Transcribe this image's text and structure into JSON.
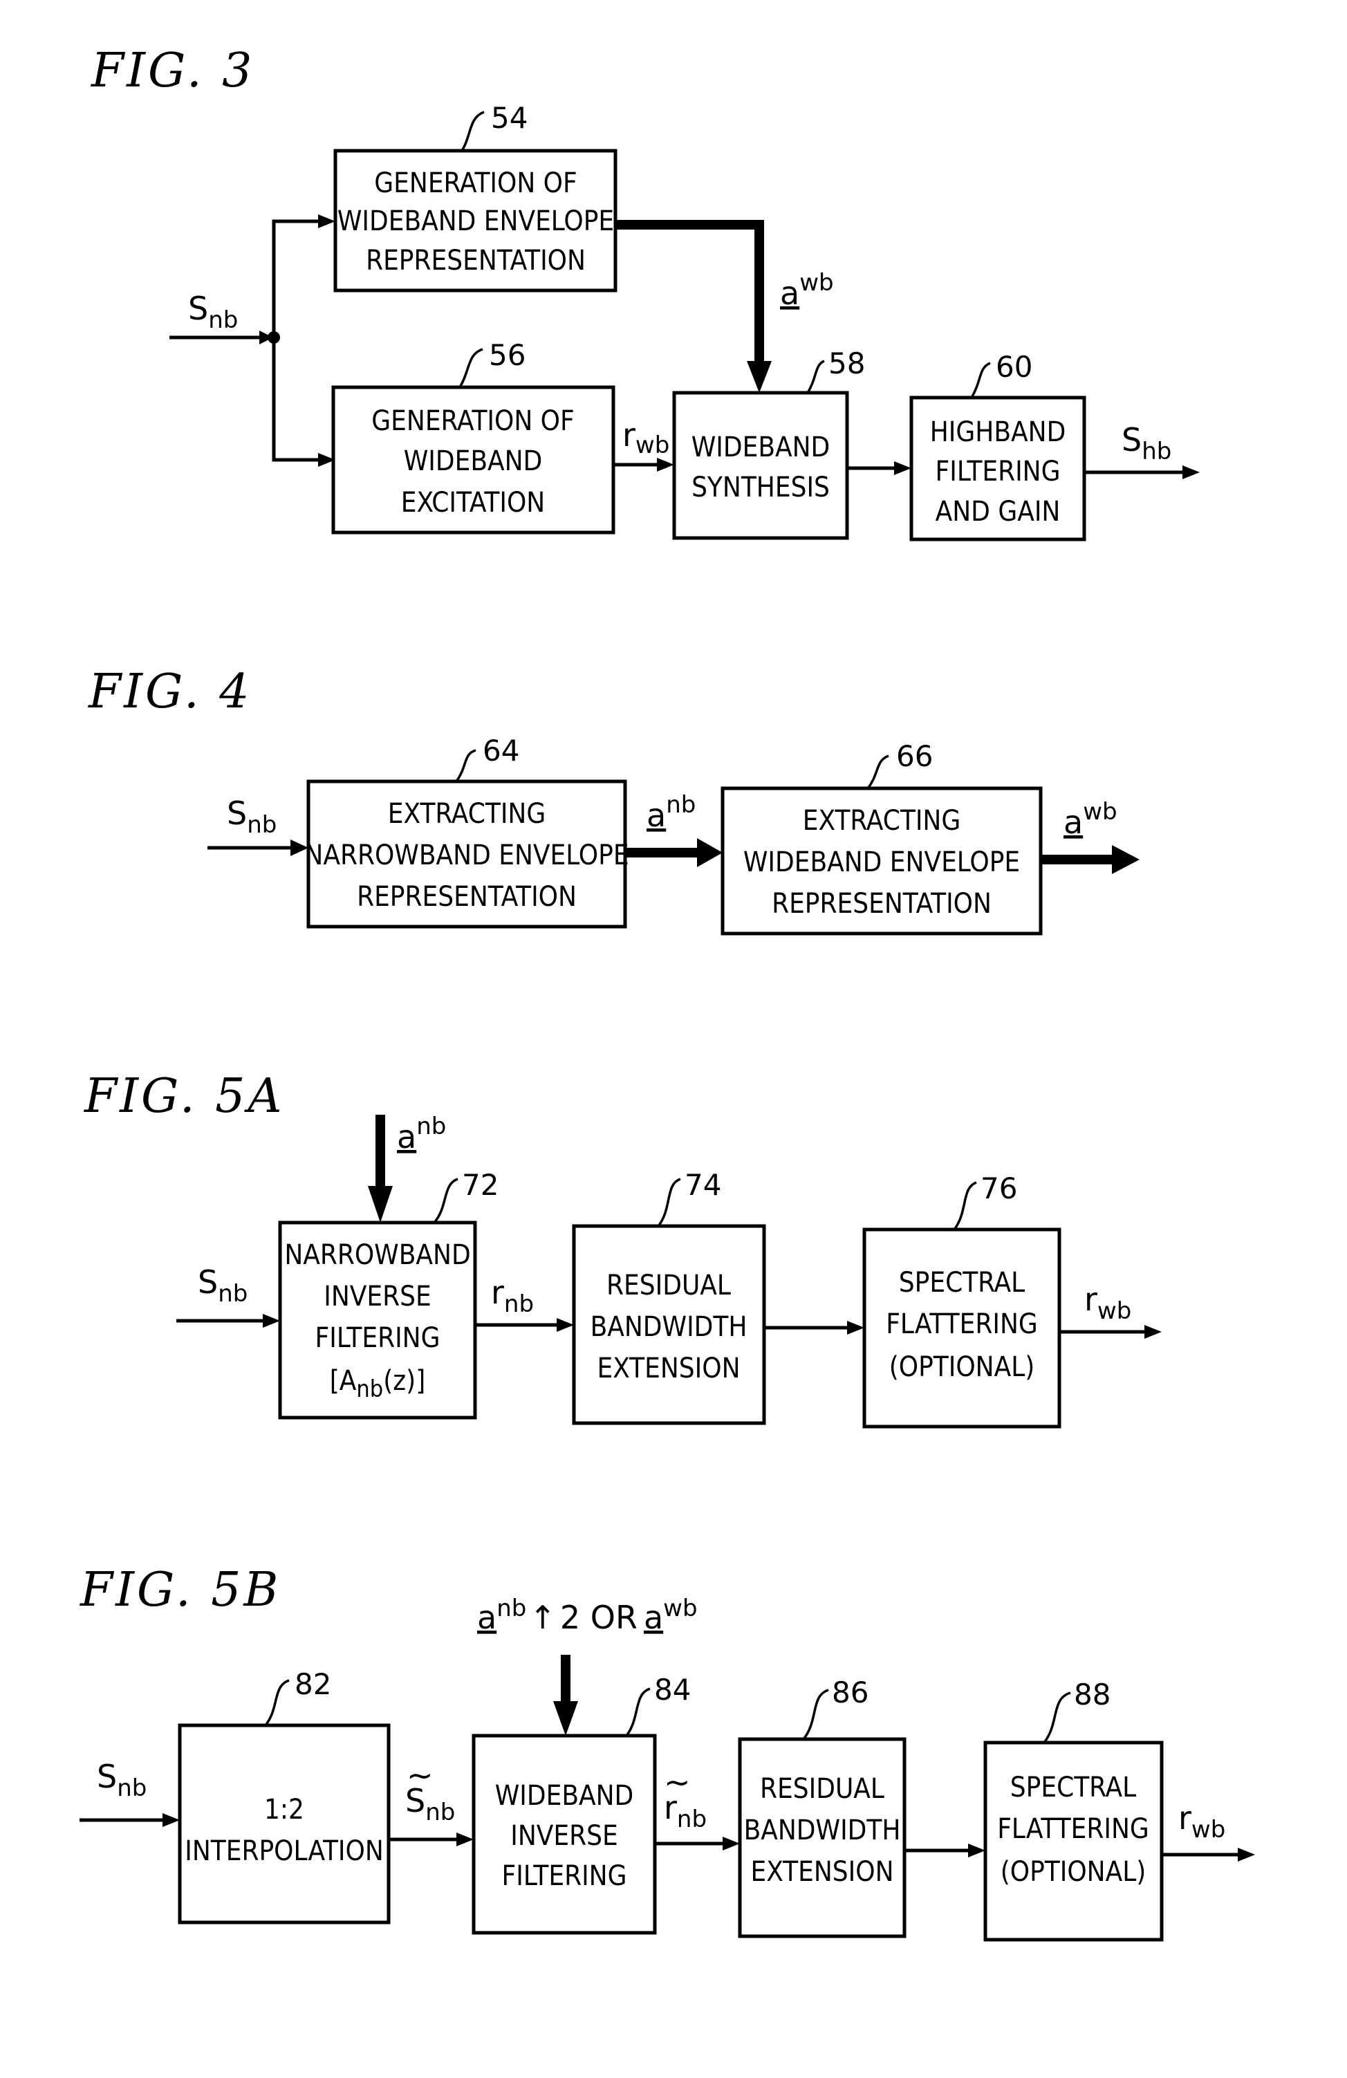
{
  "figures": [
    {
      "id": "fig3",
      "title": "FIG. 3",
      "input_label": {
        "main": "S",
        "sub": "nb"
      },
      "blocks": [
        {
          "ref": "54",
          "lines": [
            "GENERATION OF",
            "WIDEBAND ENVELOPE",
            "REPRESENTATION"
          ]
        },
        {
          "ref": "56",
          "lines": [
            "GENERATION OF",
            "WIDEBAND",
            "EXCITATION"
          ]
        },
        {
          "ref": "58",
          "lines": [
            "WIDEBAND",
            "SYNTHESIS"
          ]
        },
        {
          "ref": "60",
          "lines": [
            "HIGHBAND",
            "FILTERING",
            "AND GAIN"
          ]
        }
      ],
      "signals": {
        "envelope": {
          "main": "a",
          "sup": "wb"
        },
        "excitation": {
          "main": "r",
          "sub": "wb"
        },
        "output": {
          "main": "S",
          "sub": "hb"
        }
      }
    },
    {
      "id": "fig4",
      "title": "FIG. 4",
      "input_label": {
        "main": "S",
        "sub": "nb"
      },
      "blocks": [
        {
          "ref": "64",
          "lines": [
            "EXTRACTING",
            "NARROWBAND ENVELOPE",
            "REPRESENTATION"
          ]
        },
        {
          "ref": "66",
          "lines": [
            "EXTRACTING",
            "WIDEBAND ENVELOPE",
            "REPRESENTATION"
          ]
        }
      ],
      "signals": {
        "middle": {
          "main": "a",
          "sup": "nb"
        },
        "output": {
          "main": "a",
          "sup": "wb"
        }
      }
    },
    {
      "id": "fig5a",
      "title": "FIG. 5A",
      "input_label": {
        "main": "S",
        "sub": "nb"
      },
      "blocks": [
        {
          "ref": "72",
          "lines": [
            "NARROWBAND",
            "INVERSE",
            "FILTERING",
            "[A_nb(z)]"
          ]
        },
        {
          "ref": "74",
          "lines": [
            "RESIDUAL",
            "BANDWIDTH",
            "EXTENSION"
          ]
        },
        {
          "ref": "76",
          "lines": [
            "SPECTRAL",
            "FLATTERING",
            "(OPTIONAL)"
          ]
        }
      ],
      "signals": {
        "top_input": {
          "main": "a",
          "sup": "nb"
        },
        "middle": {
          "main": "r",
          "sub": "nb"
        },
        "output": {
          "main": "r",
          "sub": "wb"
        }
      },
      "filter_formula": {
        "prefix": "[A",
        "sub": "nb",
        "suffix": "(z)]"
      }
    },
    {
      "id": "fig5b",
      "title": "FIG. 5B",
      "input_label": {
        "main": "S",
        "sub": "nb"
      },
      "blocks": [
        {
          "ref": "82",
          "lines": [
            "1:2",
            "INTERPOLATION"
          ]
        },
        {
          "ref": "84",
          "lines": [
            "WIDEBAND",
            "INVERSE",
            "FILTERING"
          ]
        },
        {
          "ref": "86",
          "lines": [
            "RESIDUAL",
            "BANDWIDTH",
            "EXTENSION"
          ]
        },
        {
          "ref": "88",
          "lines": [
            "SPECTRAL",
            "FLATTERING",
            "(OPTIONAL)"
          ]
        }
      ],
      "signals": {
        "top_input": {
          "part1_main": "a",
          "part1_sup": "nb",
          "arrow": "↑",
          "middle": "2 OR",
          "part2_main": "a",
          "part2_sup": "wb"
        },
        "interp_out": {
          "main": "S",
          "sub": "nb",
          "accent": "~"
        },
        "filter_out": {
          "main": "r",
          "sub": "nb",
          "accent": "~"
        },
        "output": {
          "main": "r",
          "sub": "wb"
        }
      }
    }
  ]
}
